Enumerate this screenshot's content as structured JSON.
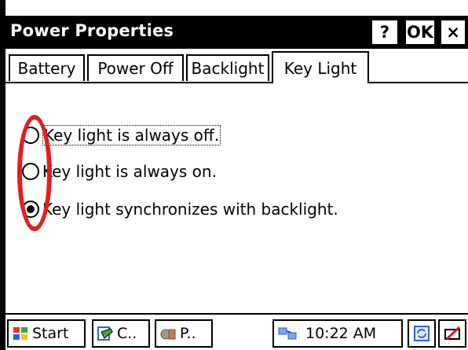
{
  "window": {
    "title": "Power Properties",
    "help_button": "?",
    "ok_button": "OK",
    "close_button": "×"
  },
  "tabs": [
    {
      "label": "Battery",
      "active": false
    },
    {
      "label": "Power Off",
      "active": false
    },
    {
      "label": "Backlight",
      "active": false
    },
    {
      "label": "Key Light",
      "active": true
    }
  ],
  "options": [
    {
      "label": "Key light is always off.",
      "selected": false
    },
    {
      "label": "Key light is always on.",
      "selected": false
    },
    {
      "label": "Key light synchronizes with backlight.",
      "selected": true
    }
  ],
  "taskbar": {
    "start_label": "Start",
    "task1_label": "C..",
    "task2_label": "P..",
    "clock": "10:22 AM"
  },
  "colors": {
    "annotation": "#e0201f"
  }
}
